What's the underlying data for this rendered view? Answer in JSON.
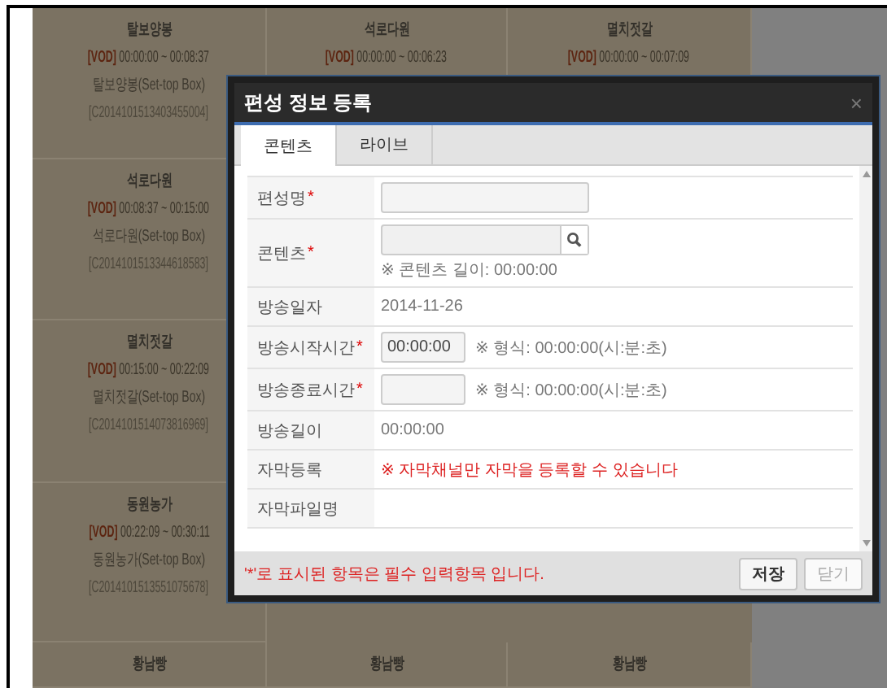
{
  "schedule": {
    "rows": [
      [
        {
          "title": "탈보양봉",
          "tag": "[VOD]",
          "time": "00:00:00 ~ 00:08:37",
          "device": "탈보양봉(Set-top Box)",
          "code": "[C2014101513403455004]"
        },
        {
          "title": "석로다원",
          "tag": "[VOD]",
          "time": "00:00:00 ~ 00:06:23"
        },
        {
          "title": "멸치젓갈",
          "tag": "[VOD]",
          "time": "00:00:00 ~ 00:07:09"
        }
      ],
      [
        {
          "title": "석로다원",
          "tag": "[VOD]",
          "time": "00:08:37 ~ 00:15:00",
          "device": "석로다원(Set-top Box)",
          "code": "[C2014101513344618583]"
        },
        {},
        {}
      ],
      [
        {
          "title": "멸치젓갈",
          "tag": "[VOD]",
          "time": "00:15:00 ~ 00:22:09",
          "device": "멸치젓갈(Set-top Box)",
          "code": "[C2014101514073816969]"
        },
        {},
        {}
      ],
      [
        {
          "title": "동원농가",
          "tag": "[VOD]",
          "time": "00:22:09 ~ 00:30:11",
          "device": "동원농가(Set-top Box)",
          "code": "[C2014101513551075678]"
        },
        {},
        {}
      ],
      [
        {
          "title": "황남빵"
        },
        {
          "title": "황남빵"
        },
        {
          "title": "황남빵"
        }
      ]
    ]
  },
  "dialog": {
    "title": "편성 정보 등록",
    "close": "×",
    "tabs": [
      {
        "label": "콘텐츠",
        "selected": true
      },
      {
        "label": "라이브",
        "selected": false
      }
    ],
    "fields": [
      {
        "label": "편성명",
        "required": "*",
        "kind": "text"
      },
      {
        "label": "콘텐츠",
        "required": "*",
        "kind": "search",
        "hint": "※ 콘텐츠 길이: 00:00:00"
      },
      {
        "label": "방송일자",
        "kind": "static",
        "value": "2014-11-26"
      },
      {
        "label": "방송시작시간",
        "required": "*",
        "kind": "time",
        "value": "00:00:00",
        "hint": "※ 형식: 00:00:00(시:분:초)"
      },
      {
        "label": "방송종료시간",
        "required": "*",
        "kind": "time",
        "hint": "※ 형식: 00:00:00(시:분:초)"
      },
      {
        "label": "방송길이",
        "kind": "static",
        "value": "00:00:00"
      },
      {
        "label": "자막등록",
        "kind": "notice",
        "value": "※ 자막채널만 자막을 등록할 수 있습니다"
      },
      {
        "label": "자막파일명",
        "kind": "static"
      }
    ],
    "footer_note": "'*'로 표시된 항목은 필수 입력항목 입니다.",
    "buttons": [
      {
        "label": "저장",
        "disabled": false
      },
      {
        "label": "닫기",
        "disabled": true
      }
    ]
  }
}
